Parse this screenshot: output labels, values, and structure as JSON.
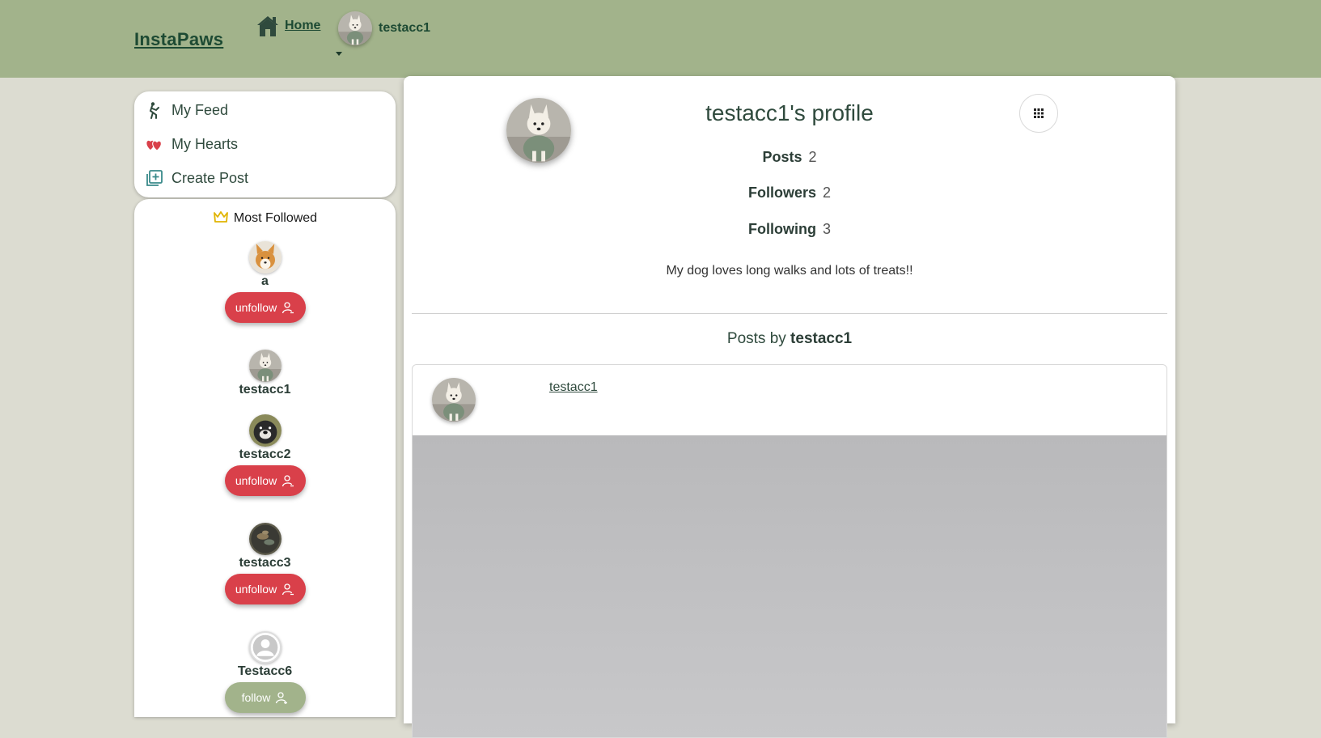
{
  "navbar": {
    "brand": "InstaPaws",
    "home_label": "Home",
    "username": "testacc1"
  },
  "menu": {
    "items": [
      {
        "label": "My Feed",
        "icon": "dog-walk-icon"
      },
      {
        "label": "My Hearts",
        "icon": "hearts-icon"
      },
      {
        "label": "Create Post",
        "icon": "add-post-icon"
      }
    ]
  },
  "most_followed": {
    "title": "Most Followed",
    "users": [
      {
        "name": "a",
        "button": "unfollow",
        "avatar": "corgi"
      },
      {
        "name": "testacc1",
        "button": "",
        "avatar": "westie"
      },
      {
        "name": "testacc2",
        "button": "unfollow",
        "avatar": "black-dog"
      },
      {
        "name": "testacc3",
        "button": "unfollow",
        "avatar": "dark-dog"
      },
      {
        "name": "Testacc6",
        "button": "follow",
        "avatar": "default"
      }
    ]
  },
  "profile": {
    "title": "testacc1's profile",
    "stats": [
      {
        "label": "Posts",
        "value": "2"
      },
      {
        "label": "Followers",
        "value": "2"
      },
      {
        "label": "Following",
        "value": "3"
      }
    ],
    "bio": "My dog loves long walks and lots of treats!!",
    "posts_by_prefix": "Posts by",
    "posts_by_user": "testacc1"
  },
  "post": {
    "username": "testacc1"
  },
  "colors": {
    "navbar": "#a2b38b",
    "background": "#dcdcd1",
    "unfollow": "#d9404a",
    "follow": "#a2b38b",
    "text_dark_green": "#1d4a33"
  }
}
